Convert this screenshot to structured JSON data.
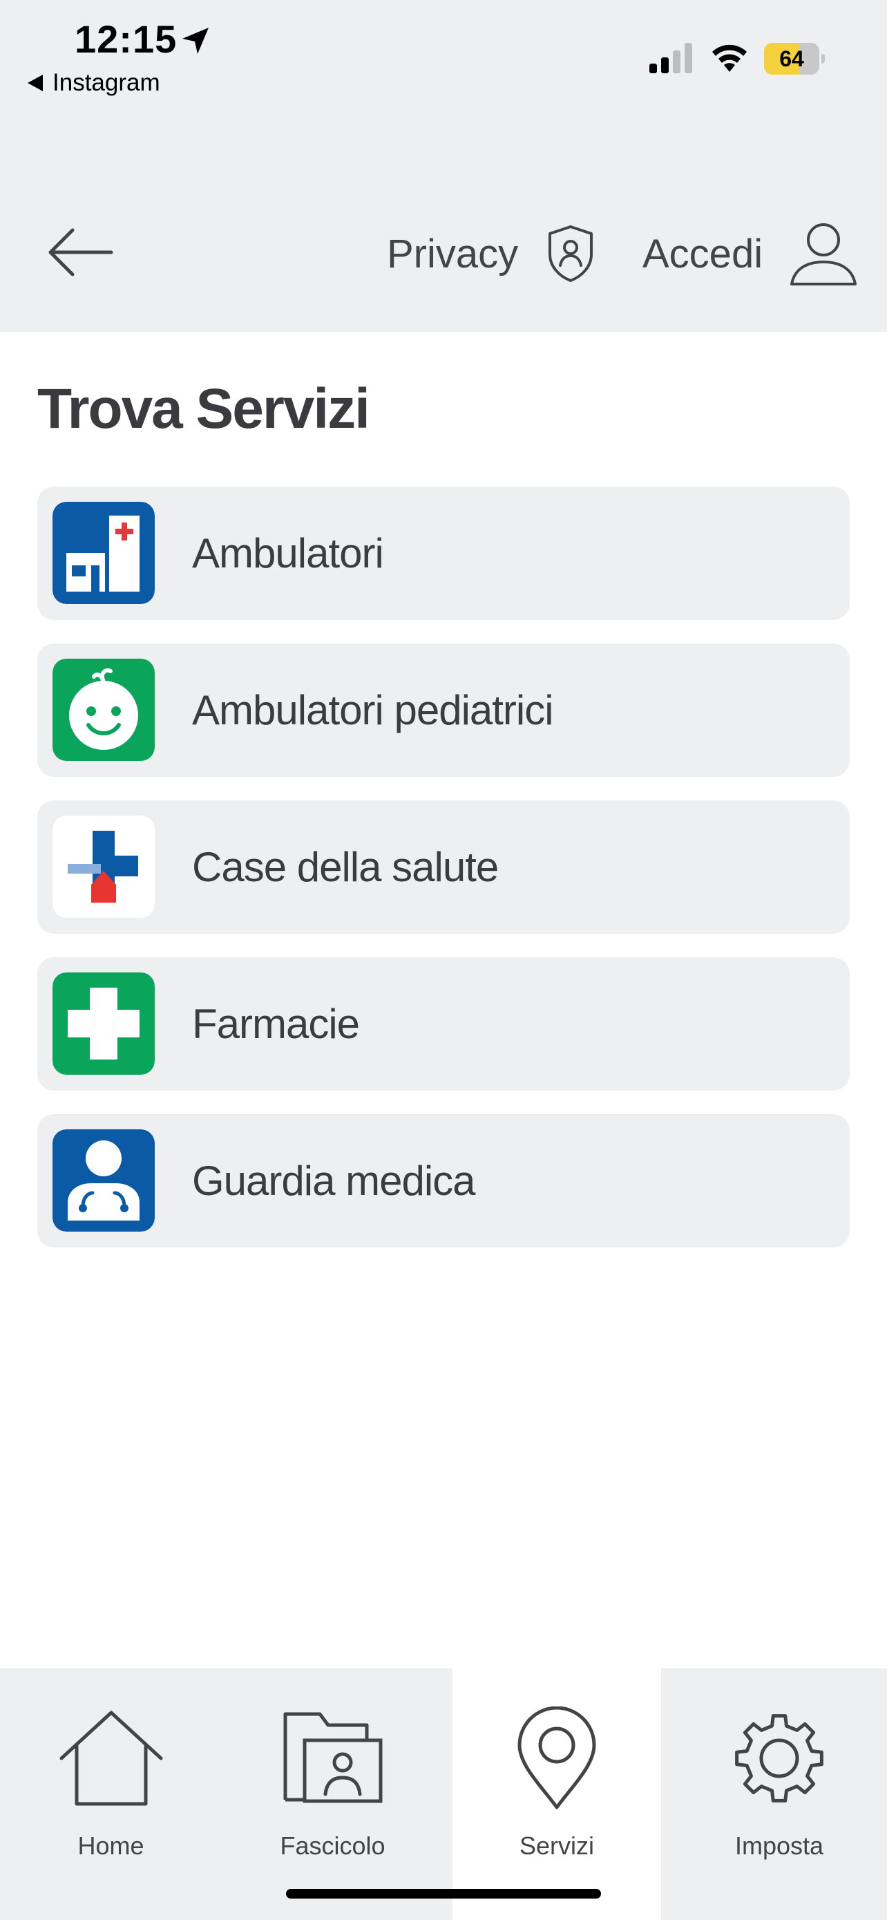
{
  "status_bar": {
    "time": "12:15",
    "back_app": "Instagram",
    "battery_level": "64",
    "battery_fraction": 0.64,
    "battery_fill_color": "#f5d13d",
    "icons": [
      "location-arrow-icon",
      "signal-icon",
      "wifi-icon",
      "battery-icon"
    ]
  },
  "header": {
    "back_icon": "arrow-left-icon",
    "privacy_label": "Privacy",
    "privacy_icon": "shield-user-icon",
    "login_label": "Accedi",
    "login_icon": "user-icon"
  },
  "main": {
    "title": "Trova Servizi",
    "services": [
      {
        "label": "Ambulatori",
        "icon": "clinic-building-icon",
        "color": "#0b5aa6"
      },
      {
        "label": "Ambulatori pediatrici",
        "icon": "baby-face-icon",
        "color": "#0aa55a"
      },
      {
        "label": "Case della salute",
        "icon": "health-house-icon",
        "color": "#ffffff"
      },
      {
        "label": "Farmacie",
        "icon": "pharmacy-cross-icon",
        "color": "#0aa55a"
      },
      {
        "label": "Guardia medica",
        "icon": "doctor-icon",
        "color": "#0b5aa6"
      }
    ]
  },
  "tab_bar": {
    "active": "Servizi",
    "tabs": [
      {
        "label": "Home",
        "icon": "home-icon"
      },
      {
        "label": "Fascicolo",
        "icon": "folder-user-icon"
      },
      {
        "label": "Servizi",
        "icon": "map-pin-icon"
      },
      {
        "label": "Imposta",
        "icon": "gear-icon"
      }
    ]
  }
}
